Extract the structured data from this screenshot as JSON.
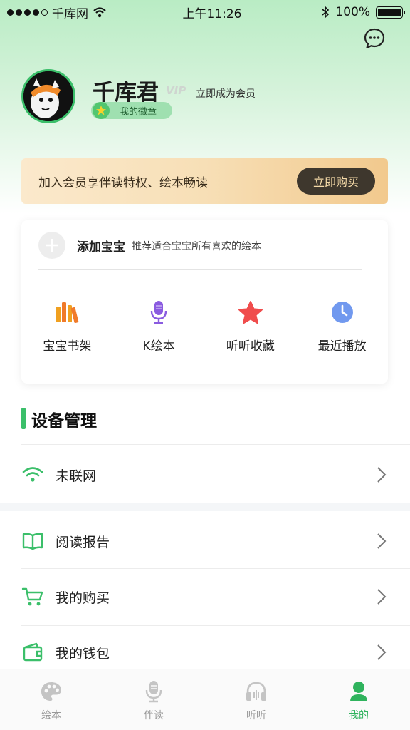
{
  "status_bar": {
    "carrier": "千库网",
    "time": "上午11:26",
    "battery": "100%",
    "battery_level": 1.0
  },
  "profile": {
    "username": "千库君",
    "vip_tag": "VIP",
    "become_member": "立即成为会员",
    "badge_label": "我的徽章"
  },
  "member_banner": {
    "text": "加入会员享伴读特权、绘本畅读",
    "button": "立即购买"
  },
  "baby_card": {
    "add_label": "添加宝宝",
    "add_sub": "推荐适合宝宝所有喜欢的绘本",
    "items": [
      {
        "label": "宝宝书架",
        "icon": "bookshelf-icon"
      },
      {
        "label": "K绘本",
        "icon": "microphone-icon"
      },
      {
        "label": "听听收藏",
        "icon": "star-icon"
      },
      {
        "label": "最近播放",
        "icon": "clock-icon"
      }
    ]
  },
  "device_section": {
    "title": "设备管理",
    "network_label": "未联网"
  },
  "menu": [
    {
      "label": "阅读报告",
      "icon": "book-icon"
    },
    {
      "label": "我的购买",
      "icon": "cart-icon"
    },
    {
      "label": "我的钱包",
      "icon": "wallet-icon"
    }
  ],
  "tabs": [
    {
      "label": "绘本",
      "icon": "palette-icon",
      "active": false
    },
    {
      "label": "伴读",
      "icon": "microphone-icon",
      "active": false
    },
    {
      "label": "听听",
      "icon": "headphones-icon",
      "active": false
    },
    {
      "label": "我的",
      "icon": "user-icon",
      "active": true
    }
  ],
  "colors": {
    "accent": "#3bbf6a",
    "banner_button": "#3e372d",
    "banner_gold": "#f2c98d"
  }
}
